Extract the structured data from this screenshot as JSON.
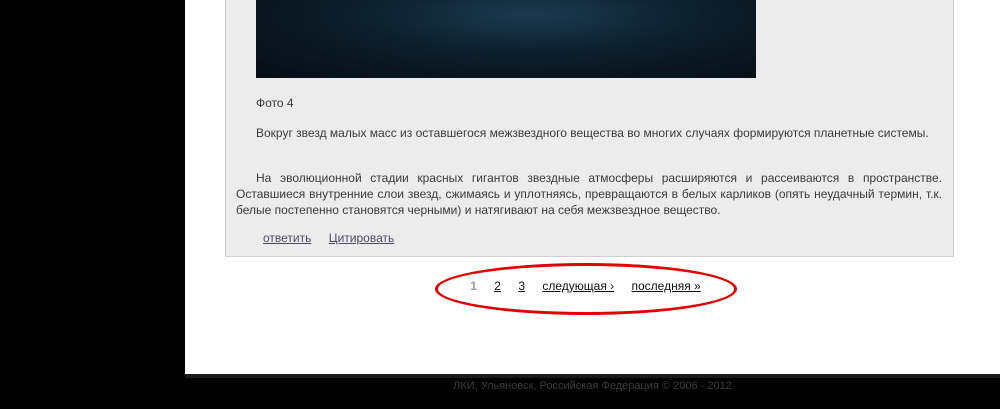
{
  "post": {
    "photo_caption": "Фото 4",
    "paragraphs": [
      "Вокруг звезд малых масс из оставшегося межзвездного вещества во многих случаях формируются планетные системы.",
      "На эволюционной стадии красных гигантов звездные атмосферы расширяются и рассеиваются в пространстве. Оставшиеся внутренние слои звезд, сжимаясь и уплотняясь, превращаются в белых карликов (опять неудачный термин, т.к. белые постепенно становятся черными) и натягивают на себя межзвездное вещество."
    ],
    "actions": {
      "reply": "ответить",
      "quote": "Цитировать"
    }
  },
  "pager": {
    "current": "1",
    "pages": [
      "2",
      "3"
    ],
    "next": "следующая ›",
    "last": "последняя »"
  },
  "footer": {
    "text": "ЛКИ, Ульяновск, Российская Федерация © 2006 - 2012"
  },
  "colors": {
    "highlight": "#e00000",
    "background": "#000000",
    "post_background": "#ececec"
  }
}
